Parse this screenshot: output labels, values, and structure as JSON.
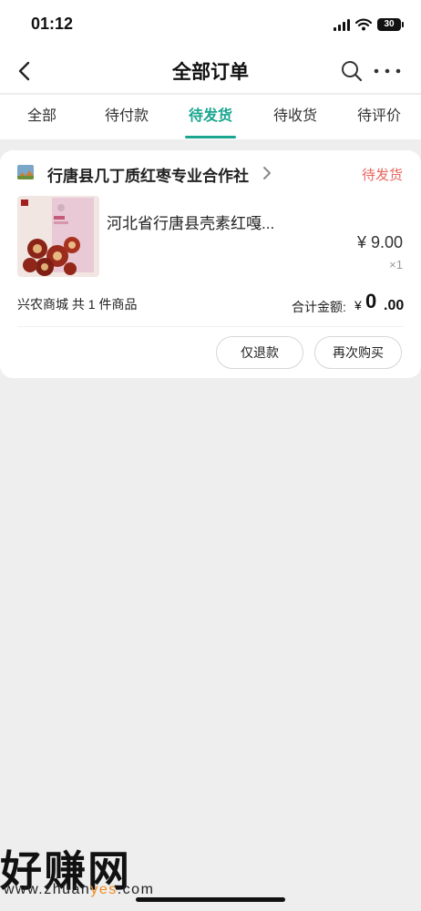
{
  "status_bar": {
    "time": "01:12",
    "battery": "30"
  },
  "nav": {
    "title": "全部订单"
  },
  "tabs": [
    {
      "label": "全部"
    },
    {
      "label": "待付款"
    },
    {
      "label": "待发货"
    },
    {
      "label": "待收货"
    },
    {
      "label": "待评价"
    }
  ],
  "active_tab": "待发货",
  "order": {
    "shop_name": "行唐县几丁质红枣专业合作社",
    "status": "待发货",
    "product_title": "河北省行唐县壳素红嘎...",
    "price": "¥ 9.00",
    "quantity": "×1",
    "summary": "兴农商城 共 1 件商品",
    "total_label": "合计金额:",
    "total_currency": "¥",
    "total_int": "0",
    "total_dec": ".00",
    "buttons": {
      "refund": "仅退款",
      "rebuy": "再次购买"
    }
  },
  "watermark": {
    "brand": "好赚网",
    "url_pre": "www.zhuan",
    "url_hl": "yes",
    "url_post": ".com"
  },
  "colors": {
    "accent": "#1aa58f",
    "status": "#e8665f",
    "background": "#eeeeee"
  }
}
